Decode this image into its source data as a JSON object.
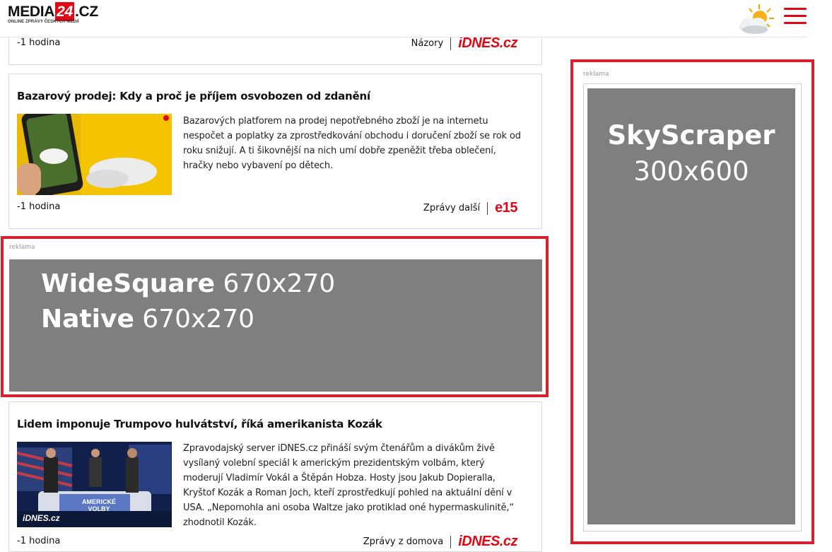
{
  "header": {
    "logo_prefix": "MEDIA",
    "logo_number": "24",
    "logo_suffix": ".CZ",
    "logo_tagline": "ONLINE ZPRÁVY ČESKÝCH MÉDIÍ",
    "weather_icon": "partly-cloudy-icon",
    "menu_icon": "hamburger-menu-icon",
    "accent_color": "#e30613"
  },
  "articles": [
    {
      "time": "-1 hodina",
      "category": "Názory",
      "source": "iDNES.cz"
    },
    {
      "title": "Bazarový prodej: Kdy a proč je příjem osvobozen od zdanění",
      "text": "Bazarových platforem na prodej nepotřebného zboží je na internetu nespočet a poplatky za zprostředkování obchodu i doručení zboží se rok od roku snižují. A ti šikovnější na nich umí dobře zpeněžit třeba oblečení, hračky nebo vybavení po dětech.",
      "time": "-1 hodina",
      "category": "Zprávy další",
      "source": "e15"
    },
    {
      "title": "Lidem imponuje Trumpovo hulvátství, říká amerikanista Kozák",
      "text": "Zpravodajský server iDNES.cz přináší svým čtenářům a divákům živě vysílaný volební speciál k americkým prezidentským volbám, který moderují Vladimír Vokál a Štěpán Hobza. Hosty jsou Jakub Dopieralla, Kryštof Kozák a Roman Joch, kteří zprostředkují pohled na aktuální dění v USA. „Nepomohla ani osoba Waltze jako protiklad oné hypermaskulinitě,“ zhodnotil Kozák.",
      "time": "-1 hodina",
      "category": "Zprávy z domova",
      "source": "iDNES.cz",
      "thumb_caption": "AMERICKÉ VOLBY",
      "thumb_brand": "iDNES.cz"
    }
  ],
  "ads": {
    "wide": {
      "label": "reklama",
      "line1_bold": "WideSquare",
      "line1_rest": " 670x270",
      "line2_bold": "Native",
      "line2_rest": " 670x270"
    },
    "sky": {
      "label": "reklama",
      "line1": "SkyScraper",
      "line2": "300x600"
    },
    "border_color": "#d8202f",
    "fill_color": "#7f7f7f"
  }
}
